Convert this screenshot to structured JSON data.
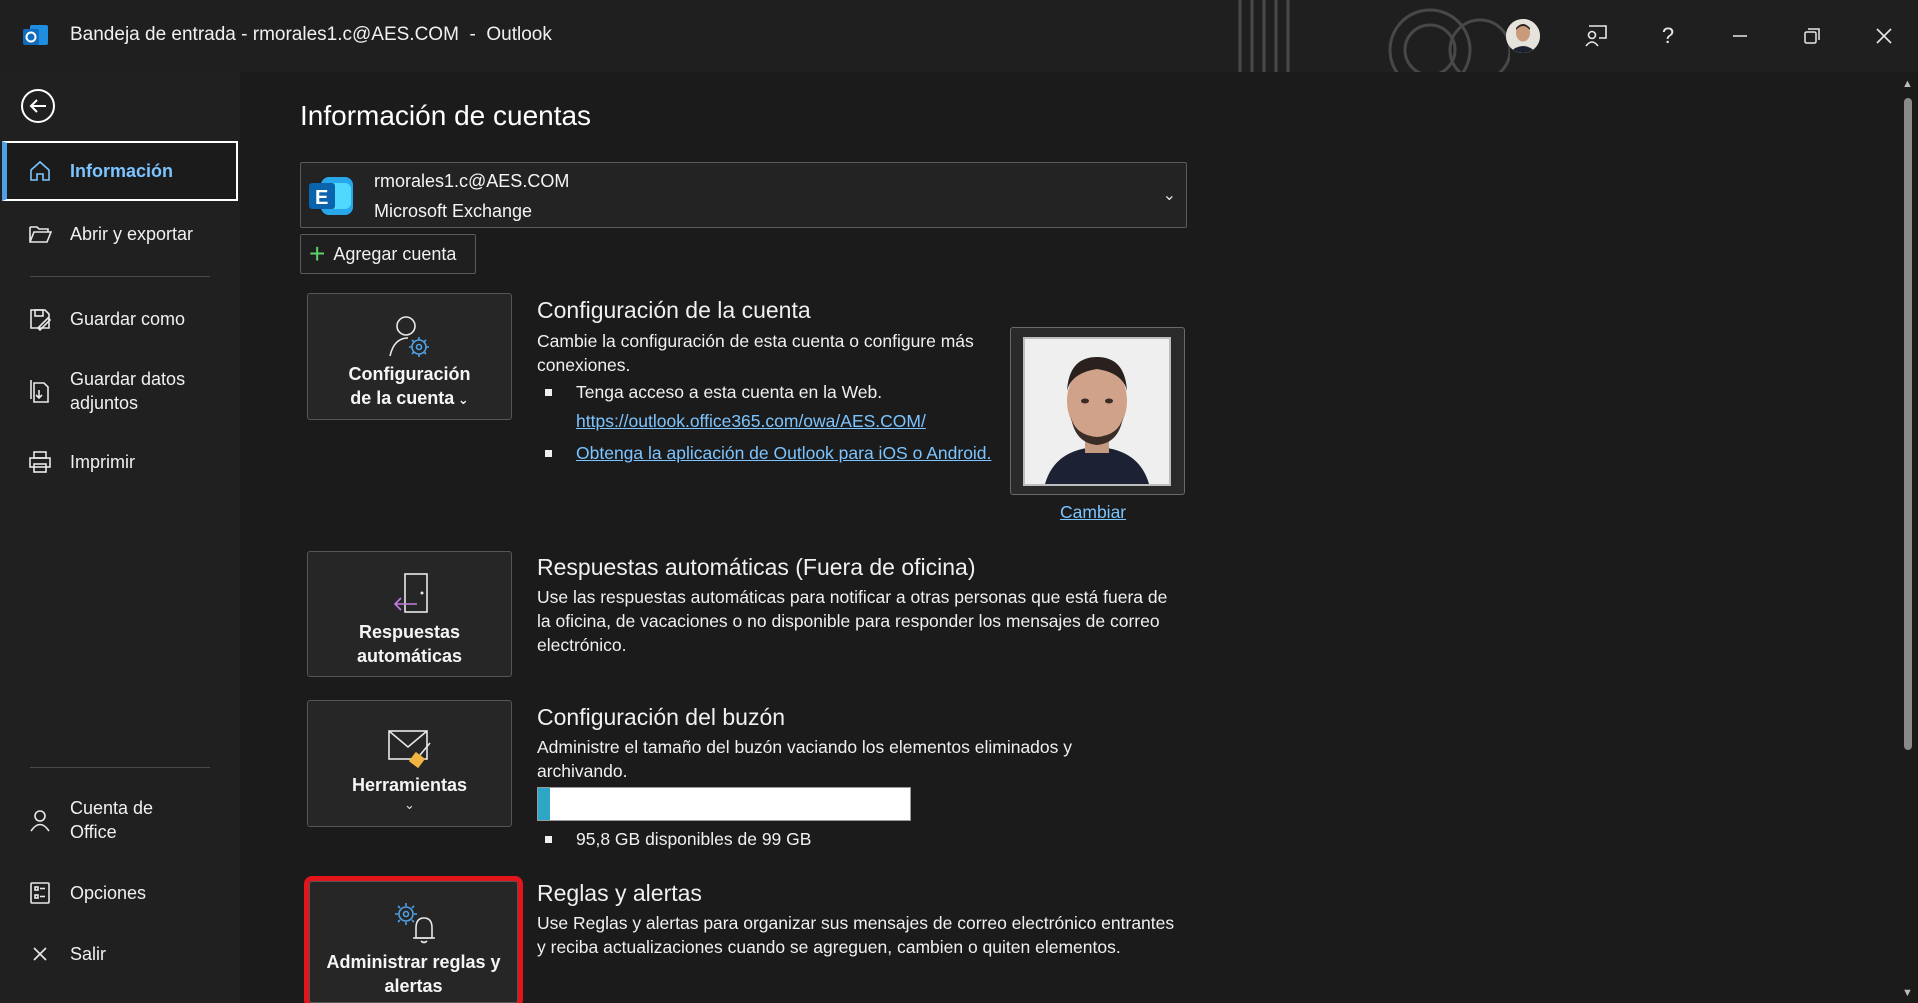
{
  "titlebar": {
    "title": "Bandeja de entrada - rmorales1.c@AES.COM  -  Outlook",
    "help": "?"
  },
  "sidebar": {
    "items": [
      {
        "label": "Información"
      },
      {
        "label": "Abrir y exportar"
      },
      {
        "label": "Guardar como"
      },
      {
        "label": "Guardar datos adjuntos"
      },
      {
        "label": "Imprimir"
      },
      {
        "label": "Cuenta de Office"
      },
      {
        "label": "Opciones"
      },
      {
        "label": "Salir"
      }
    ]
  },
  "main": {
    "page_title": "Información de cuentas",
    "account": {
      "email": "rmorales1.c@AES.COM",
      "type": "Microsoft Exchange"
    },
    "add_account": "Agregar cuenta",
    "account_settings": {
      "tile_label_1": "Configuración",
      "tile_label_2": "de la cuenta",
      "title": "Configuración de la cuenta",
      "description": "Cambie la configuración de esta cuenta o configure más conexiones.",
      "bullet_web": "Tenga acceso a esta cuenta en la Web.",
      "web_link": "https://outlook.office365.com/owa/AES.COM/",
      "mobile_link": "Obtenga la aplicación de Outlook para iOS o Android.",
      "change_photo": "Cambiar"
    },
    "auto_replies": {
      "tile_label": "Respuestas automáticas",
      "title": "Respuestas automáticas (Fuera de oficina)",
      "description": "Use las respuestas automáticas para notificar a otras personas que está fuera de la oficina, de vacaciones o no disponible para responder los mensajes de correo electrónico."
    },
    "mailbox": {
      "tile_label": "Herramientas",
      "title": "Configuración del buzón",
      "description": "Administre el tamaño del buzón vaciando los elementos eliminados y archivando.",
      "usage_fraction": 0.032,
      "usage_text": "95,8 GB disponibles de 99 GB"
    },
    "rules": {
      "tile_label": "Administrar reglas y alertas",
      "title": "Reglas y alertas",
      "description": "Use Reglas y alertas para organizar sus mensajes de correo electrónico entrantes y reciba actualizaciones cuando se agreguen, cambien o quiten elementos."
    }
  },
  "colors": {
    "accent": "#4fa0e6",
    "link": "#7cc4ff",
    "highlight": "#e3151a",
    "usage_fill": "#2ea6c7"
  }
}
